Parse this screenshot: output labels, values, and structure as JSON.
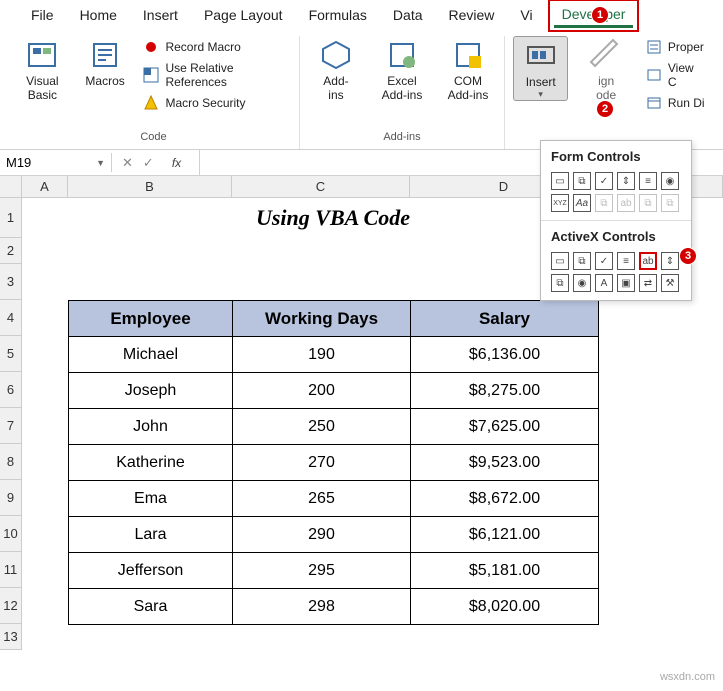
{
  "tabs": {
    "file": "File",
    "home": "Home",
    "insert": "Insert",
    "page_layout": "Page Layout",
    "formulas": "Formulas",
    "data": "Data",
    "review": "Review",
    "view_partial": "Vi",
    "developer": "Developer"
  },
  "ribbon": {
    "code": {
      "visual_basic": "Visual\nBasic",
      "macros": "Macros",
      "record_macro": "Record Macro",
      "use_relative": "Use Relative References",
      "macro_security": "Macro Security",
      "group_label": "Code"
    },
    "addins": {
      "addins": "Add-\nins",
      "excel_addins": "Excel\nAdd-ins",
      "com_addins": "COM\nAdd-ins",
      "group_label": "Add-ins"
    },
    "controls": {
      "insert": "Insert",
      "design_mode_partial": "ign\node",
      "properties_partial": "Proper",
      "view_code_partial": "View C",
      "run_dialog_partial": "Run Di"
    }
  },
  "callouts": {
    "c1": "1",
    "c2": "2",
    "c3": "3"
  },
  "formula_bar": {
    "name_box": "M19",
    "cancel": "✕",
    "enter": "✓",
    "fx": "fx"
  },
  "columns": [
    "A",
    "B",
    "C",
    "D"
  ],
  "rows": [
    "1",
    "2",
    "3",
    "4",
    "5",
    "6",
    "7",
    "8",
    "9",
    "10",
    "11",
    "12",
    "13"
  ],
  "sheet": {
    "title": "Using VBA Code",
    "headers": {
      "employee": "Employee",
      "working_days": "Working Days",
      "salary": "Salary"
    },
    "data": [
      {
        "employee": "Michael",
        "days": "190",
        "salary": "$6,136.00"
      },
      {
        "employee": "Joseph",
        "days": "200",
        "salary": "$8,275.00"
      },
      {
        "employee": "John",
        "days": "250",
        "salary": "$7,625.00"
      },
      {
        "employee": "Katherine",
        "days": "270",
        "salary": "$9,523.00"
      },
      {
        "employee": "Ema",
        "days": "265",
        "salary": "$8,672.00"
      },
      {
        "employee": "Lara",
        "days": "290",
        "salary": "$6,121.00"
      },
      {
        "employee": "Jefferson",
        "days": "295",
        "salary": "$5,181.00"
      },
      {
        "employee": "Sara",
        "days": "298",
        "salary": "$8,020.00"
      }
    ]
  },
  "dropdown": {
    "form_controls": "Form Controls",
    "activex_controls": "ActiveX Controls",
    "form_row1": [
      "button-icon",
      "combo-icon",
      "checkbox-icon",
      "spin-icon",
      "list-icon",
      "option-icon"
    ],
    "form_row2_labels": [
      "XYZ",
      "Aa"
    ],
    "ax_row1": [
      "button-icon",
      "combo-icon",
      "checkbox-icon",
      "list-icon",
      "textbox-icon",
      "scrollbar-icon"
    ],
    "ax_row2": [
      "spin-icon",
      "option-icon",
      "label-icon",
      "image-icon",
      "toggle-icon",
      "more-icon"
    ]
  },
  "watermark": "wsxdn.com",
  "chart_data": {
    "type": "table",
    "title": "Using VBA Code",
    "columns": [
      "Employee",
      "Working Days",
      "Salary"
    ],
    "rows": [
      [
        "Michael",
        190,
        6136.0
      ],
      [
        "Joseph",
        200,
        8275.0
      ],
      [
        "John",
        250,
        7625.0
      ],
      [
        "Katherine",
        270,
        9523.0
      ],
      [
        "Ema",
        265,
        8672.0
      ],
      [
        "Lara",
        290,
        6121.0
      ],
      [
        "Jefferson",
        295,
        5181.0
      ],
      [
        "Sara",
        298,
        8020.0
      ]
    ],
    "currency": "USD"
  }
}
